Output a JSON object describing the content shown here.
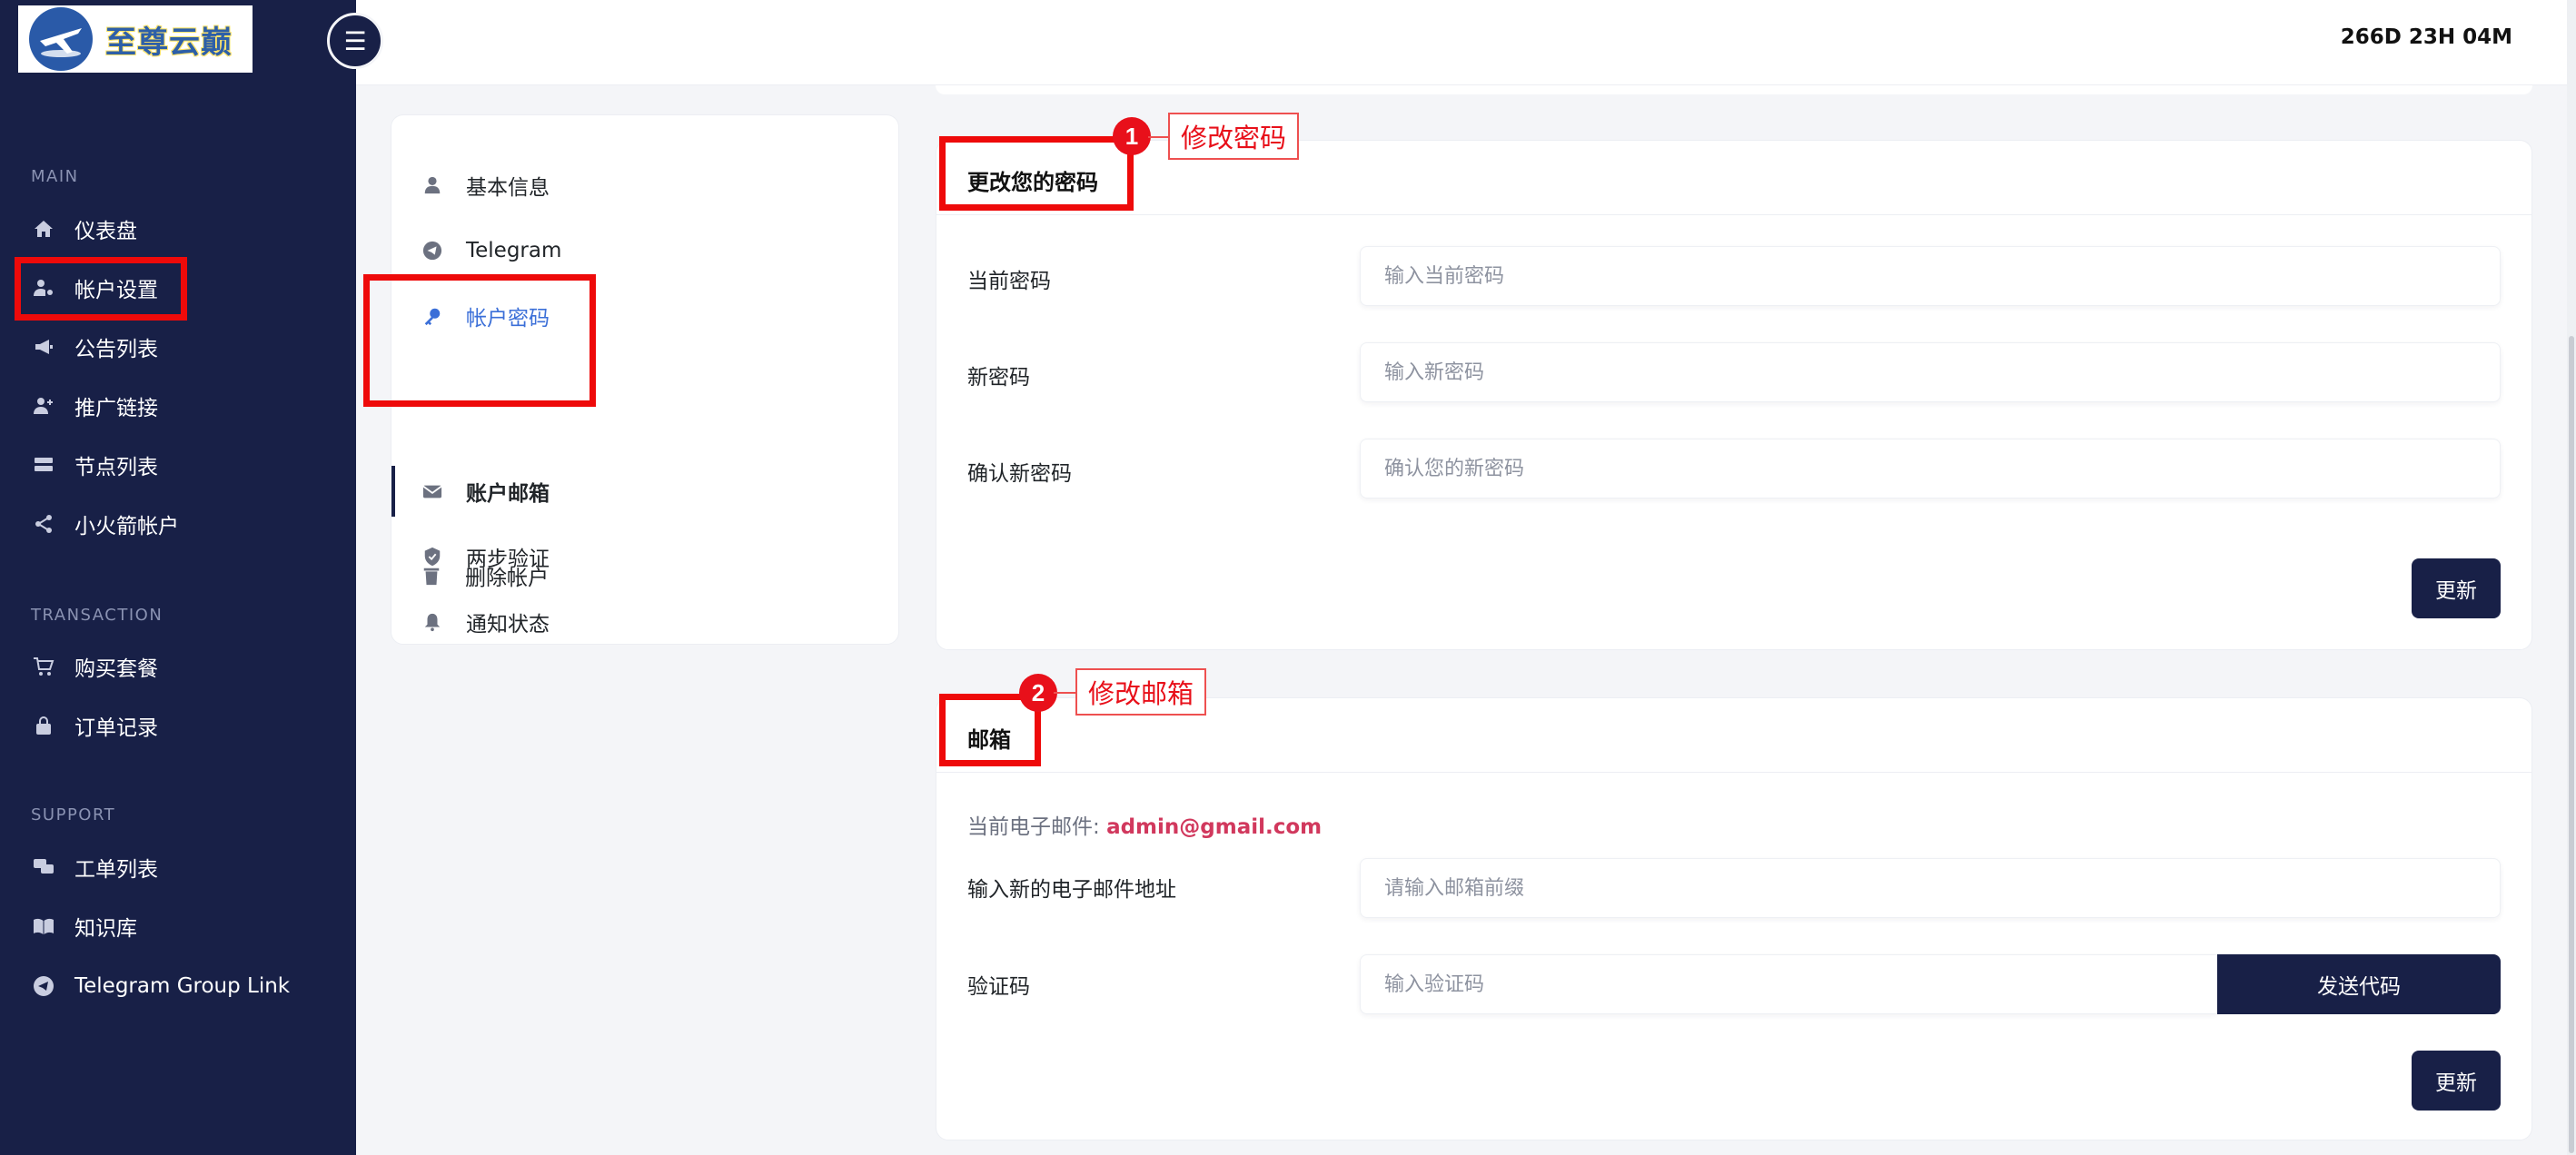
{
  "brand": {
    "logo_text": "至尊云巅"
  },
  "topbar": {
    "timer": "266D 23H 04M"
  },
  "sidebar": {
    "sections": [
      {
        "title": "MAIN"
      },
      {
        "title": "TRANSACTION"
      },
      {
        "title": "SUPPORT"
      }
    ],
    "items": [
      {
        "label": "仪表盘",
        "icon": "home-icon"
      },
      {
        "label": "帐户设置",
        "icon": "user-gear-icon"
      },
      {
        "label": "公告列表",
        "icon": "megaphone-icon"
      },
      {
        "label": "推广链接",
        "icon": "user-plus-icon"
      },
      {
        "label": "节点列表",
        "icon": "server-icon"
      },
      {
        "label": "小火箭帐户",
        "icon": "share-icon"
      },
      {
        "label": "购买套餐",
        "icon": "cart-icon"
      },
      {
        "label": "订单记录",
        "icon": "lock-icon"
      },
      {
        "label": "工单列表",
        "icon": "chat-icon"
      },
      {
        "label": "知识库",
        "icon": "book-icon"
      },
      {
        "label": "Telegram Group Link",
        "icon": "telegram-icon"
      }
    ]
  },
  "settings_nav": {
    "items": [
      {
        "label": "基本信息",
        "icon": "user-icon"
      },
      {
        "label": "Telegram",
        "icon": "telegram-icon"
      },
      {
        "label": "帐户密码",
        "icon": "key-icon"
      },
      {
        "label": "账户邮箱",
        "icon": "envelope-icon"
      },
      {
        "label": "两步验证",
        "icon": "shield-icon"
      },
      {
        "label": "通知状态",
        "icon": "bell-icon"
      },
      {
        "label": "删除帐户",
        "icon": "trash-icon"
      }
    ],
    "active_index": 2
  },
  "password_card": {
    "title": "更改您的密码",
    "fields": [
      {
        "label": "当前密码",
        "placeholder": "输入当前密码"
      },
      {
        "label": "新密码",
        "placeholder": "输入新密码"
      },
      {
        "label": "确认新密码",
        "placeholder": "确认您的新密码"
      }
    ],
    "submit_label": "更新"
  },
  "email_card": {
    "title": "邮箱",
    "current_email_label": "当前电子邮件:",
    "current_email": "admin@gmail.com",
    "new_email_label": "输入新的电子邮件地址",
    "new_email_placeholder": "请输入邮箱前缀",
    "code_label": "验证码",
    "code_placeholder": "输入验证码",
    "send_code_label": "发送代码",
    "submit_label": "更新"
  },
  "annotations": [
    {
      "number": "1",
      "text": "修改密码"
    },
    {
      "number": "2",
      "text": "修改邮箱"
    }
  ],
  "colors": {
    "sidebar_bg": "#182047",
    "accent": "#3b6fd8",
    "annotation_red": "#ee0a0a",
    "email_highlight": "#d1385d"
  }
}
